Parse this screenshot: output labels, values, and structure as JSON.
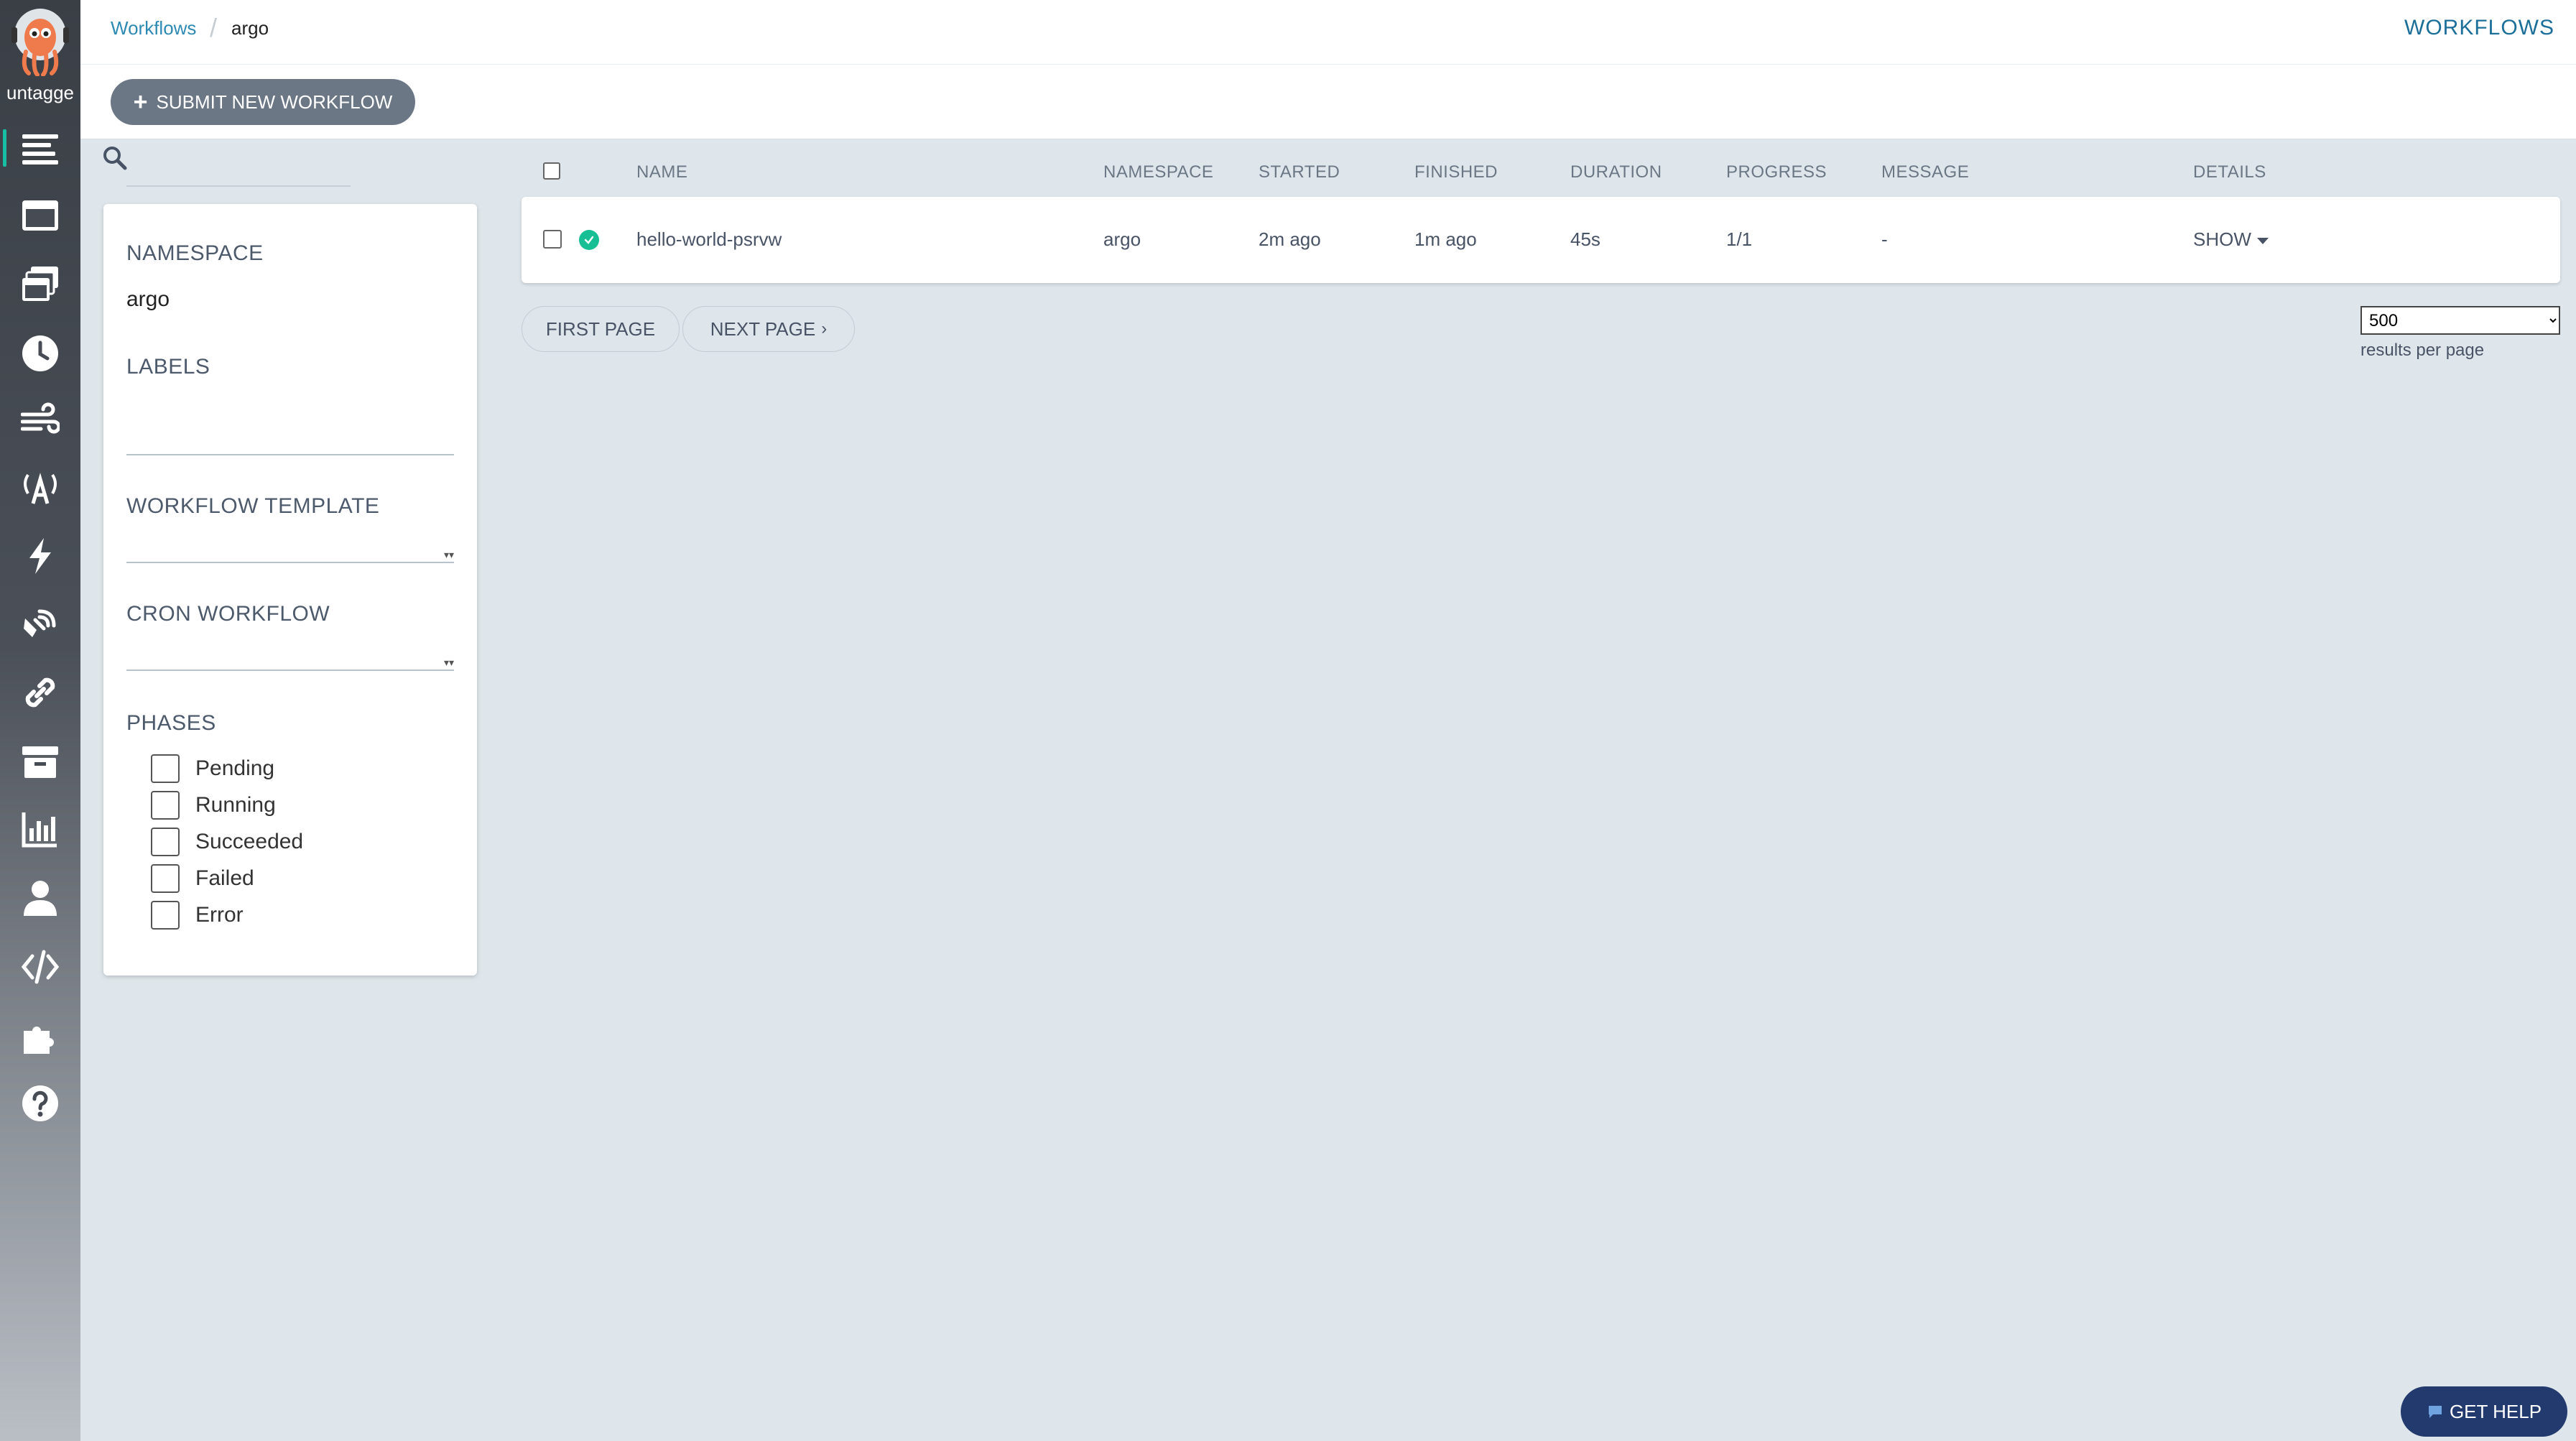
{
  "sidebar": {
    "version_label": "untagge",
    "items": [
      {
        "icon": "workflows-icon"
      },
      {
        "icon": "workflow-templates-icon"
      },
      {
        "icon": "cluster-workflow-templates-icon"
      },
      {
        "icon": "cron-workflows-icon"
      },
      {
        "icon": "event-flow-icon"
      },
      {
        "icon": "event-sources-icon"
      },
      {
        "icon": "sensors-icon"
      },
      {
        "icon": "event-bus-icon"
      },
      {
        "icon": "links-icon"
      },
      {
        "icon": "archived-workflows-icon"
      },
      {
        "icon": "reports-icon"
      },
      {
        "icon": "user-icon"
      },
      {
        "icon": "api-docs-icon"
      },
      {
        "icon": "plugins-icon"
      },
      {
        "icon": "help-icon"
      }
    ]
  },
  "topbar": {
    "breadcrumb_link": "Workflows",
    "breadcrumb_current": "argo",
    "title": "WORKFLOWS"
  },
  "actions": {
    "submit_label": "SUBMIT NEW WORKFLOW"
  },
  "filters": {
    "search_placeholder": "",
    "namespace_heading": "NAMESPACE",
    "namespace_value": "argo",
    "labels_heading": "LABELS",
    "workflow_template_heading": "WORKFLOW TEMPLATE",
    "cron_workflow_heading": "CRON WORKFLOW",
    "phases_heading": "PHASES",
    "phases": [
      "Pending",
      "Running",
      "Succeeded",
      "Failed",
      "Error"
    ]
  },
  "table": {
    "columns": [
      "NAME",
      "NAMESPACE",
      "STARTED",
      "FINISHED",
      "DURATION",
      "PROGRESS",
      "MESSAGE",
      "DETAILS"
    ],
    "rows": [
      {
        "status": "succeeded",
        "name": "hello-world-psrvw",
        "namespace": "argo",
        "started": "2m ago",
        "finished": "1m ago",
        "duration": "45s",
        "progress": "1/1",
        "message": "-",
        "details": "SHOW"
      }
    ]
  },
  "pagination": {
    "first_page": "FIRST PAGE",
    "next_page": "NEXT PAGE",
    "per_page_value": "500",
    "per_page_label": "results per page"
  },
  "help": {
    "label": "GET HELP"
  },
  "colors": {
    "accent": "#18bea4",
    "link": "#2e8ab3",
    "success": "#18be94",
    "submit_button": "#6b7785",
    "help_button": "#233a6e"
  }
}
